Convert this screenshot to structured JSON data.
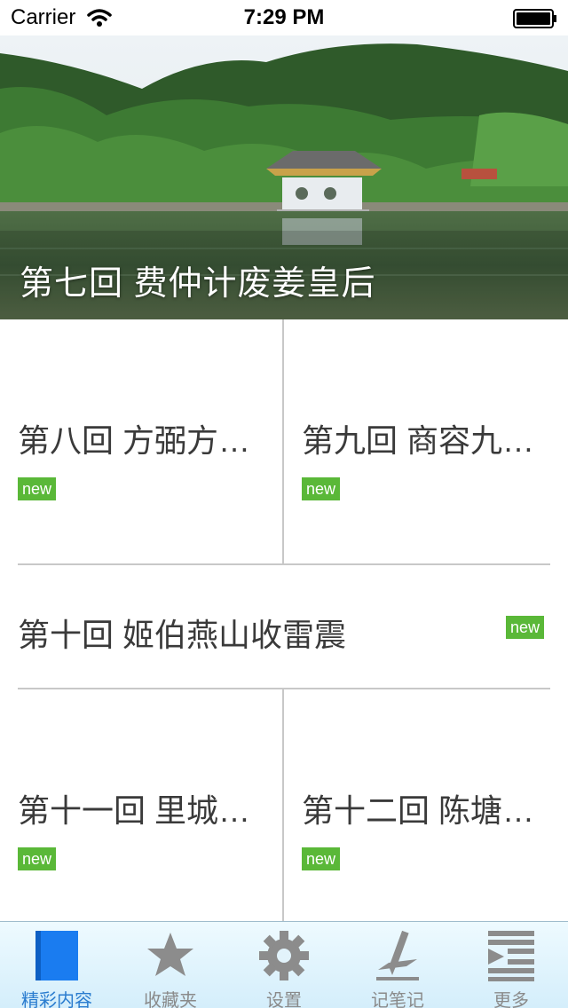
{
  "status_bar": {
    "carrier": "Carrier",
    "time": "7:29 PM"
  },
  "hero": {
    "title": "第七回 费仲计废姜皇后"
  },
  "items": [
    {
      "title": "第八回 方弼方…",
      "badge": "new"
    },
    {
      "title": "第九回 商容九…",
      "badge": "new"
    },
    {
      "title": "第十回 姬伯燕山收雷震",
      "badge": "new"
    },
    {
      "title": "第十一回 里城…",
      "badge": "new"
    },
    {
      "title": "第十二回 陈塘…",
      "badge": "new"
    }
  ],
  "tabs": [
    {
      "label": "精彩内容",
      "icon": "book-icon",
      "active": true
    },
    {
      "label": "收藏夹",
      "icon": "star-icon",
      "active": false
    },
    {
      "label": "设置",
      "icon": "gear-icon",
      "active": false
    },
    {
      "label": "记笔记",
      "icon": "pen-icon",
      "active": false
    },
    {
      "label": "更多",
      "icon": "more-menu-icon",
      "active": false
    }
  ],
  "colors": {
    "badge": "#5ab838",
    "active_tab": "#2a7ccf",
    "inactive_tab": "#8a8a8a"
  }
}
